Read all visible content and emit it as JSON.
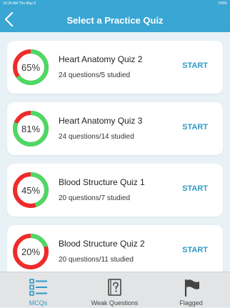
{
  "statusbar": {
    "time": "10:34 AM  Thu May 8",
    "battery": "100%"
  },
  "header": {
    "title": "Select a Practice Quiz"
  },
  "colors": {
    "accent": "#3aa6d3",
    "progress_done": "#4cd964",
    "progress_rest": "#ee2b2b"
  },
  "quizzes": [
    {
      "title": "Heart Anatomy Quiz 2",
      "percent_label": "65%",
      "percent": 65,
      "subtitle": "24 questions/5 studied",
      "action": "START"
    },
    {
      "title": "Heart Anatomy Quiz 3",
      "percent_label": "81%",
      "percent": 81,
      "subtitle": "24 questions/14 studied",
      "action": "START"
    },
    {
      "title": "Blood Structure Quiz 1",
      "percent_label": "45%",
      "percent": 45,
      "subtitle": "20 questions/7 studied",
      "action": "START"
    },
    {
      "title": "Blood Structure Quiz 2",
      "percent_label": "20%",
      "percent": 20,
      "subtitle": "20 questions/11 studied",
      "action": "START"
    }
  ],
  "tabs": [
    {
      "label": "MCQs",
      "icon": "list-icon",
      "active": true
    },
    {
      "label": "Weak Questions",
      "icon": "question-book-icon",
      "active": false
    },
    {
      "label": "Flagged",
      "icon": "flag-icon",
      "active": false
    }
  ]
}
